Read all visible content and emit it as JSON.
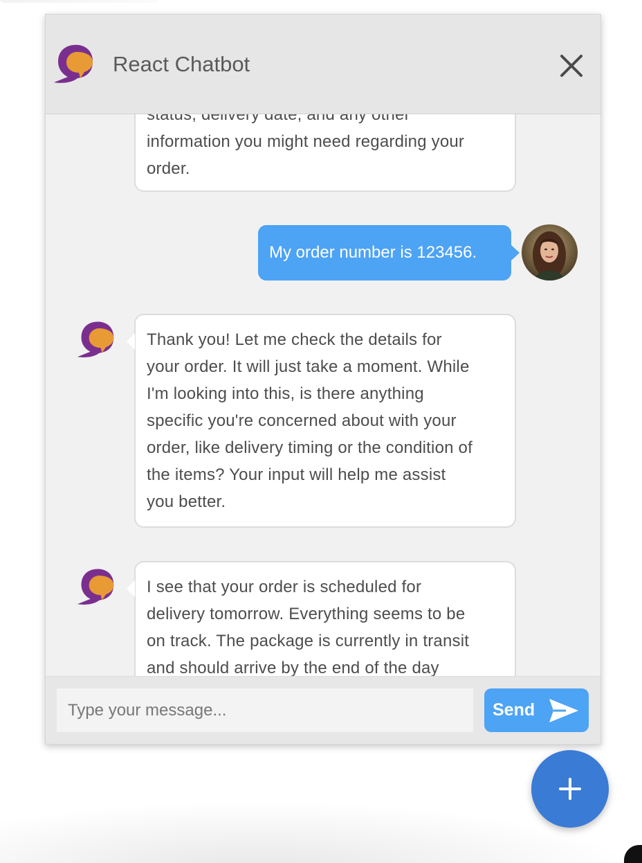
{
  "header": {
    "title": "React Chatbot",
    "logo_icon": "chat-bubbles-icon",
    "close_icon": "close-icon"
  },
  "messages": [
    {
      "sender": "bot",
      "lines": [
        "status, delivery date, and any other",
        "information you might need regarding your",
        "order."
      ]
    },
    {
      "sender": "user",
      "text": "My order number is 123456."
    },
    {
      "sender": "bot",
      "lines": [
        "Thank you! Let me check the details for",
        "your order. It will just take a moment. While",
        "I'm looking into this, is there anything",
        "specific you're concerned about with your",
        "order, like delivery timing or the condition of",
        "the items? Your input will help me assist",
        "you better."
      ]
    },
    {
      "sender": "bot",
      "lines": [
        "I see that your order is scheduled for",
        "delivery tomorrow. Everything seems to be",
        "on track. The package is currently in transit",
        "and should arrive by the end of the day"
      ]
    }
  ],
  "input": {
    "placeholder": "Type your message...",
    "value": ""
  },
  "send_button": {
    "label": "Send",
    "icon": "send-arrow-icon"
  },
  "fab": {
    "icon": "plus-icon"
  },
  "colors": {
    "accent_blue": "#4da3f4",
    "fab_blue": "#3a7bd5",
    "logo_purple": "#7a2f8f",
    "logo_orange": "#e89a34",
    "header_bg": "#e6e6e6",
    "body_bg": "#f1f1f1"
  }
}
